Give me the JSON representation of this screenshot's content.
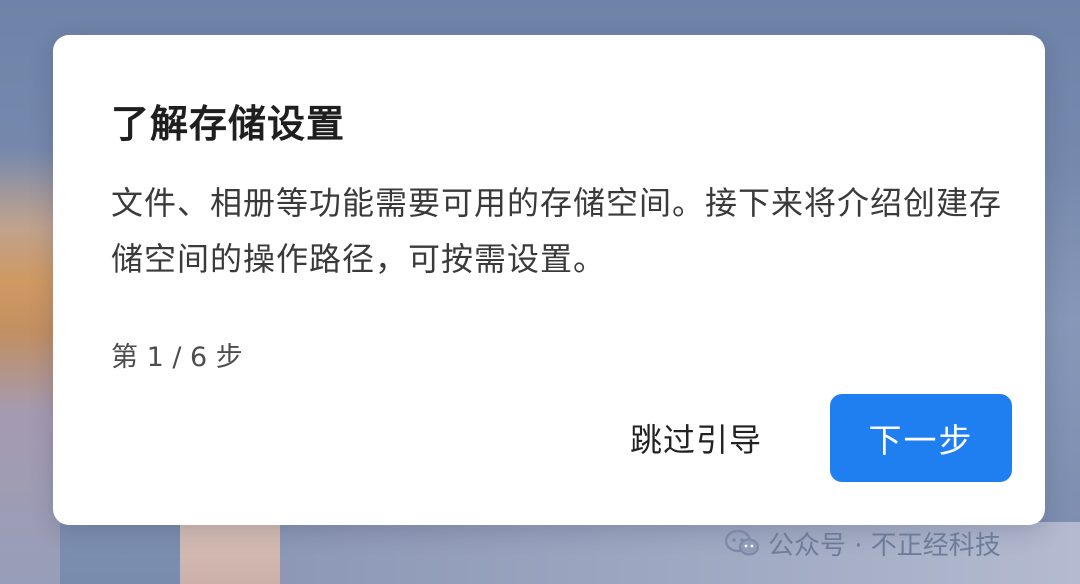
{
  "dialog": {
    "title": "了解存储设置",
    "body": "文件、相册等功能需要可用的存储空间。接下来将介绍创建存储空间的操作路径，可按需设置。",
    "step_indicator": "第 1 / 6 步",
    "skip_label": "跳过引导",
    "next_label": "下一步"
  },
  "watermark": {
    "text": "公众号 · 不正经科技"
  },
  "colors": {
    "primary_button": "#1f7ff0",
    "dialog_bg": "#ffffff",
    "title_text": "#1f1f1f"
  },
  "icons": {
    "watermark_icon": "wechat-icon"
  }
}
